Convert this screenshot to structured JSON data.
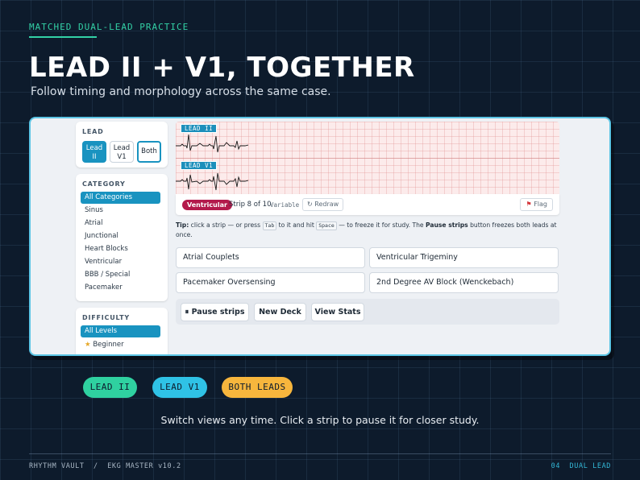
{
  "slide": {
    "kicker": "MATCHED DUAL-LEAD PRACTICE",
    "title": "LEAD II + V1, TOGETHER",
    "subtitle": "Follow timing and morphology across the same case.",
    "caption": "Switch views any time. Click a strip to pause it for closer study.",
    "chips": [
      {
        "label": "LEAD II",
        "color": "#2fd1a0"
      },
      {
        "label": "LEAD V1",
        "color": "#2fc2e6"
      },
      {
        "label": "BOTH LEADS",
        "color": "#f7b63d"
      }
    ],
    "footer_left": "RHYTHM VAULT  /  EKG MASTER v10.2",
    "footer_right": "04  DUAL LEAD"
  },
  "app": {
    "lead_panel": {
      "title": "LEAD",
      "buttons": [
        {
          "line1": "Lead",
          "line2": "II"
        },
        {
          "line1": "Lead",
          "line2": "V1"
        },
        {
          "label": "Both"
        }
      ]
    },
    "category_panel": {
      "title": "CATEGORY",
      "items": [
        "All Categories",
        "Sinus",
        "Atrial",
        "Junctional",
        "Heart Blocks",
        "Ventricular",
        "BBB / Special",
        "Pacemaker"
      ]
    },
    "difficulty_panel": {
      "title": "DIFFICULTY",
      "items": [
        "All Levels",
        "Beginner"
      ]
    },
    "strips": {
      "tags": [
        "LEAD II",
        "LEAD V1"
      ],
      "rhythm_badge": "Ventricular",
      "count": "Strip 8 of 10",
      "variable": "Variable",
      "redraw": "↻ Redraw",
      "flag": "Flag"
    },
    "tip": {
      "prefix": "Tip:",
      "t1": " click a strip — or press ",
      "k1": "Tab",
      "t2": " to it and hit ",
      "k2": "Space",
      "t3": " — to freeze it for study. The ",
      "bold": "Pause strips",
      "t4": " button freezes both leads at once."
    },
    "answers": [
      "Atrial Couplets",
      "Ventricular Trigeminy",
      "Pacemaker Oversensing",
      "2nd Degree AV Block (Wenckebach)"
    ],
    "controls": {
      "pause": "⏸ Pause strips",
      "new_deck": "New Deck",
      "view_stats": "View Stats"
    }
  },
  "colors": {
    "accent": "#1993c0",
    "badge": "#b3194b",
    "kicker": "#33d1a6"
  }
}
